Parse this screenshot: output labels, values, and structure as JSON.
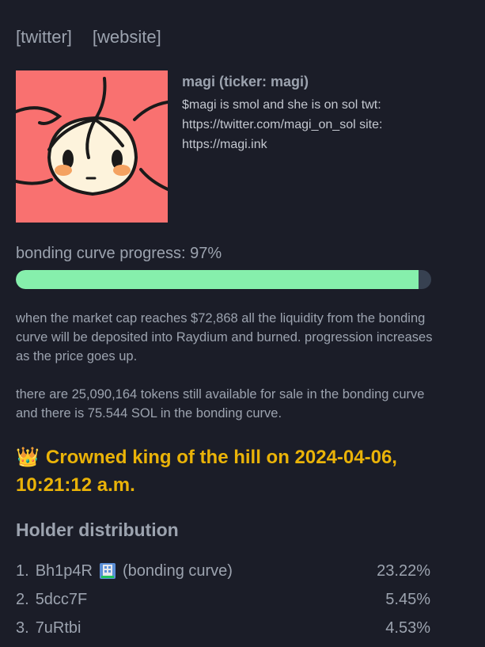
{
  "links": {
    "twitter": "[twitter]",
    "website": "[website]"
  },
  "coin": {
    "name": "magi (ticker: magi)",
    "description": "$magi is smol and she is on sol twt: https://twitter.com/magi_on_sol site: https://magi.ink",
    "image_icon": "anime-girl-face-icon"
  },
  "progress": {
    "label": "bonding curve progress: 97%",
    "percent": 97
  },
  "info": {
    "para1": "when the market cap reaches $72,868 all the liquidity from the bonding curve will be deposited into Raydium and burned. progression increases as the price goes up.",
    "para2": "there are 25,090,164 tokens still available for sale in the bonding curve and there is 75.544 SOL in the bonding curve."
  },
  "king": {
    "icon": "👑",
    "text": "Crowned king of the hill on 2024-04-06, 10:21:12 a.m."
  },
  "holders": {
    "title": "Holder distribution",
    "items": [
      {
        "rank": "1.",
        "address": "Bh1p4R",
        "note": "(bonding curve)",
        "percent": "23.22%",
        "icon": "building-icon"
      },
      {
        "rank": "2.",
        "address": "5dcc7F",
        "note": "",
        "percent": "5.45%"
      },
      {
        "rank": "3.",
        "address": "7uRtbi",
        "note": "",
        "percent": "4.53%"
      }
    ]
  },
  "colors": {
    "background": "#1b1d28",
    "progress_fill": "#86efac",
    "progress_track": "#374151",
    "king": "#eab308",
    "avatar_bg": "#f97170"
  }
}
